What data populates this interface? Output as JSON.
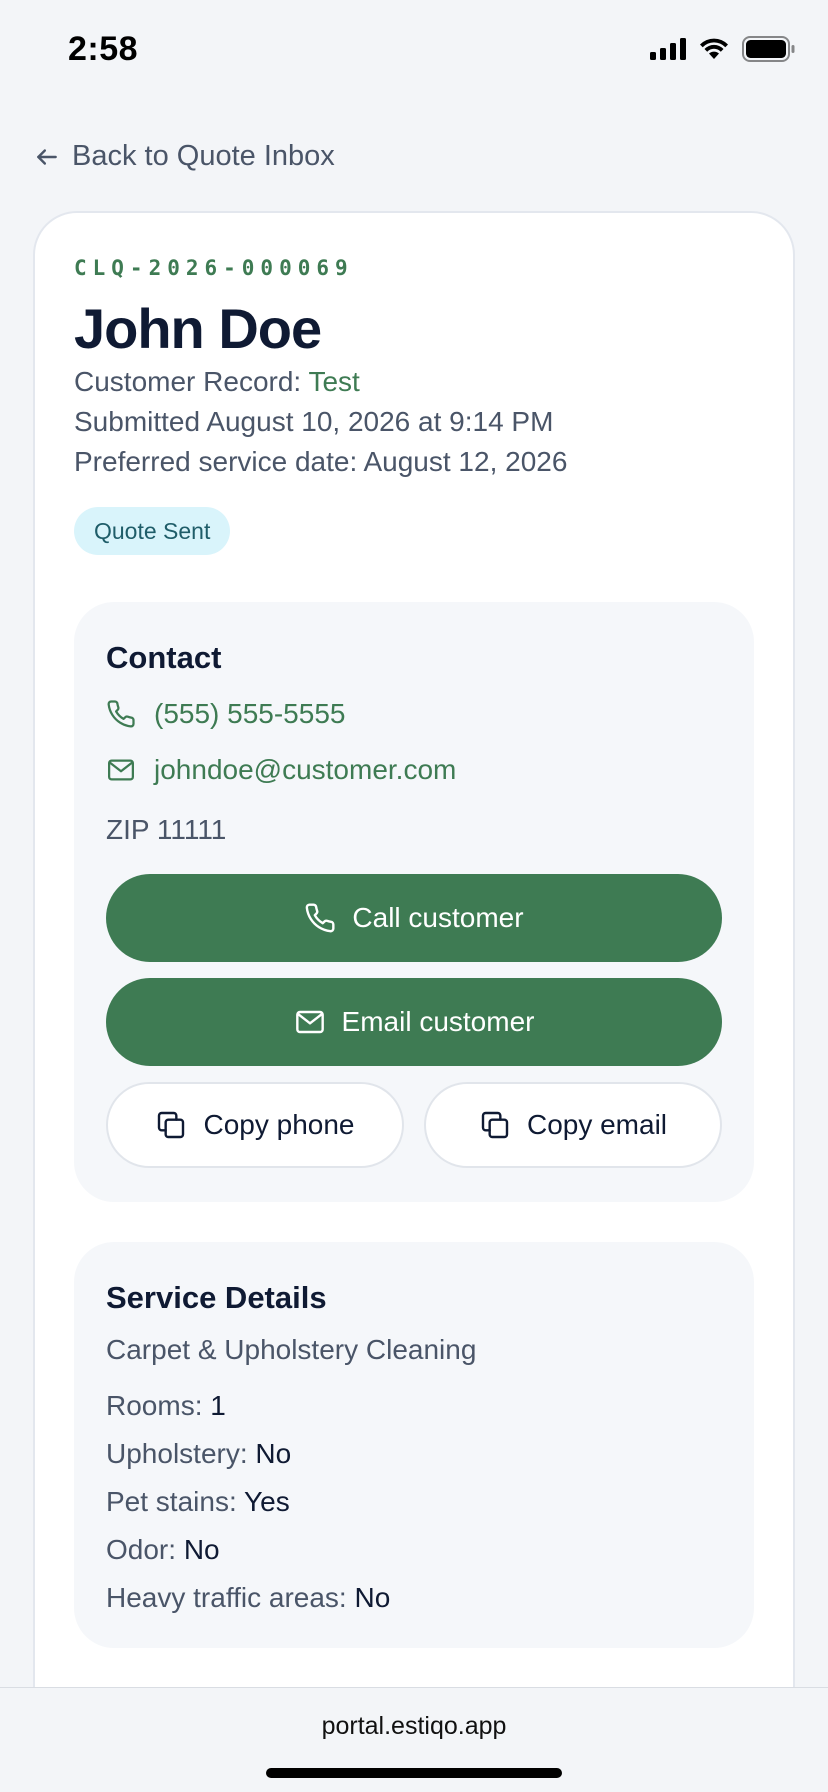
{
  "status_bar": {
    "time": "2:58"
  },
  "nav": {
    "back_label": "Back to Quote Inbox"
  },
  "quote": {
    "id": "CLQ-2026-000069",
    "customer_name": "John Doe",
    "record_label": "Customer Record: ",
    "record_value": "Test",
    "submitted": "Submitted August 10, 2026 at 9:14 PM",
    "preferred_date": "Preferred service date: August 12, 2026",
    "status": "Quote Sent"
  },
  "contact": {
    "title": "Contact",
    "phone": "(555) 555-5555",
    "email": "johndoe@customer.com",
    "zip": "ZIP 11111",
    "call_label": "Call customer",
    "email_label": "Email customer",
    "copy_phone_label": "Copy phone",
    "copy_email_label": "Copy email"
  },
  "service": {
    "title": "Service Details",
    "type": "Carpet & Upholstery Cleaning",
    "details": [
      {
        "label": "Rooms: ",
        "value": "1"
      },
      {
        "label": "Upholstery: ",
        "value": "No"
      },
      {
        "label": "Pet stains: ",
        "value": "Yes"
      },
      {
        "label": "Odor: ",
        "value": "No"
      },
      {
        "label": "Heavy traffic areas: ",
        "value": "No"
      }
    ]
  },
  "browser": {
    "url": "portal.estiqo.app"
  },
  "colors": {
    "accent": "#3e7b53",
    "badge_bg": "#d9f4fb",
    "text": "#0f1a33"
  }
}
